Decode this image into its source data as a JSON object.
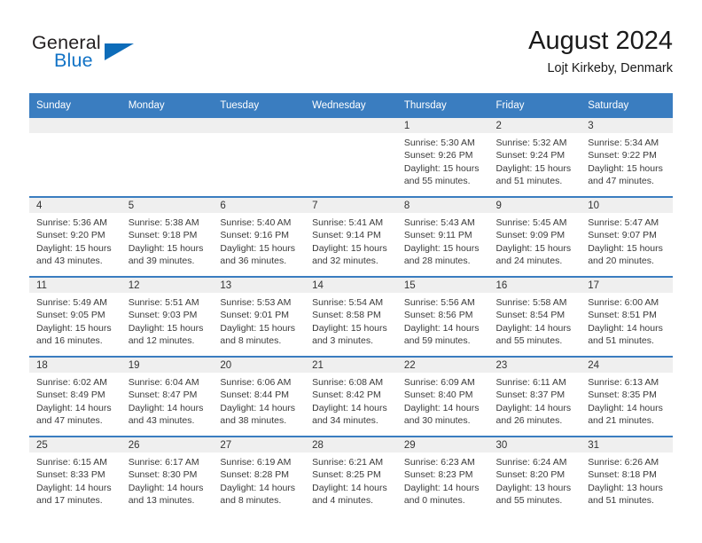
{
  "brand": {
    "word1": "General",
    "word2": "Blue",
    "logo_icon": "blue-triangle-icon",
    "colors": {
      "general": "#231f20",
      "blue": "#1273c6",
      "triangle": "#0d6cb9"
    }
  },
  "header": {
    "title": "August 2024",
    "subtitle": "Lojt Kirkeby, Denmark"
  },
  "calendar": {
    "header_bg": "#3a7dc0",
    "daynum_bg": "#efefef",
    "weekday_labels": [
      "Sunday",
      "Monday",
      "Tuesday",
      "Wednesday",
      "Thursday",
      "Friday",
      "Saturday"
    ],
    "weeks": [
      [
        {
          "day": "",
          "empty": true,
          "sunrise": "",
          "sunset": "",
          "daylight_line1": "",
          "daylight_line2": ""
        },
        {
          "day": "",
          "empty": true,
          "sunrise": "",
          "sunset": "",
          "daylight_line1": "",
          "daylight_line2": ""
        },
        {
          "day": "",
          "empty": true,
          "sunrise": "",
          "sunset": "",
          "daylight_line1": "",
          "daylight_line2": ""
        },
        {
          "day": "",
          "empty": true,
          "sunrise": "",
          "sunset": "",
          "daylight_line1": "",
          "daylight_line2": ""
        },
        {
          "day": "1",
          "empty": false,
          "sunrise": "Sunrise: 5:30 AM",
          "sunset": "Sunset: 9:26 PM",
          "daylight_line1": "Daylight: 15 hours",
          "daylight_line2": "and 55 minutes."
        },
        {
          "day": "2",
          "empty": false,
          "sunrise": "Sunrise: 5:32 AM",
          "sunset": "Sunset: 9:24 PM",
          "daylight_line1": "Daylight: 15 hours",
          "daylight_line2": "and 51 minutes."
        },
        {
          "day": "3",
          "empty": false,
          "sunrise": "Sunrise: 5:34 AM",
          "sunset": "Sunset: 9:22 PM",
          "daylight_line1": "Daylight: 15 hours",
          "daylight_line2": "and 47 minutes."
        }
      ],
      [
        {
          "day": "4",
          "empty": false,
          "sunrise": "Sunrise: 5:36 AM",
          "sunset": "Sunset: 9:20 PM",
          "daylight_line1": "Daylight: 15 hours",
          "daylight_line2": "and 43 minutes."
        },
        {
          "day": "5",
          "empty": false,
          "sunrise": "Sunrise: 5:38 AM",
          "sunset": "Sunset: 9:18 PM",
          "daylight_line1": "Daylight: 15 hours",
          "daylight_line2": "and 39 minutes."
        },
        {
          "day": "6",
          "empty": false,
          "sunrise": "Sunrise: 5:40 AM",
          "sunset": "Sunset: 9:16 PM",
          "daylight_line1": "Daylight: 15 hours",
          "daylight_line2": "and 36 minutes."
        },
        {
          "day": "7",
          "empty": false,
          "sunrise": "Sunrise: 5:41 AM",
          "sunset": "Sunset: 9:14 PM",
          "daylight_line1": "Daylight: 15 hours",
          "daylight_line2": "and 32 minutes."
        },
        {
          "day": "8",
          "empty": false,
          "sunrise": "Sunrise: 5:43 AM",
          "sunset": "Sunset: 9:11 PM",
          "daylight_line1": "Daylight: 15 hours",
          "daylight_line2": "and 28 minutes."
        },
        {
          "day": "9",
          "empty": false,
          "sunrise": "Sunrise: 5:45 AM",
          "sunset": "Sunset: 9:09 PM",
          "daylight_line1": "Daylight: 15 hours",
          "daylight_line2": "and 24 minutes."
        },
        {
          "day": "10",
          "empty": false,
          "sunrise": "Sunrise: 5:47 AM",
          "sunset": "Sunset: 9:07 PM",
          "daylight_line1": "Daylight: 15 hours",
          "daylight_line2": "and 20 minutes."
        }
      ],
      [
        {
          "day": "11",
          "empty": false,
          "sunrise": "Sunrise: 5:49 AM",
          "sunset": "Sunset: 9:05 PM",
          "daylight_line1": "Daylight: 15 hours",
          "daylight_line2": "and 16 minutes."
        },
        {
          "day": "12",
          "empty": false,
          "sunrise": "Sunrise: 5:51 AM",
          "sunset": "Sunset: 9:03 PM",
          "daylight_line1": "Daylight: 15 hours",
          "daylight_line2": "and 12 minutes."
        },
        {
          "day": "13",
          "empty": false,
          "sunrise": "Sunrise: 5:53 AM",
          "sunset": "Sunset: 9:01 PM",
          "daylight_line1": "Daylight: 15 hours",
          "daylight_line2": "and 8 minutes."
        },
        {
          "day": "14",
          "empty": false,
          "sunrise": "Sunrise: 5:54 AM",
          "sunset": "Sunset: 8:58 PM",
          "daylight_line1": "Daylight: 15 hours",
          "daylight_line2": "and 3 minutes."
        },
        {
          "day": "15",
          "empty": false,
          "sunrise": "Sunrise: 5:56 AM",
          "sunset": "Sunset: 8:56 PM",
          "daylight_line1": "Daylight: 14 hours",
          "daylight_line2": "and 59 minutes."
        },
        {
          "day": "16",
          "empty": false,
          "sunrise": "Sunrise: 5:58 AM",
          "sunset": "Sunset: 8:54 PM",
          "daylight_line1": "Daylight: 14 hours",
          "daylight_line2": "and 55 minutes."
        },
        {
          "day": "17",
          "empty": false,
          "sunrise": "Sunrise: 6:00 AM",
          "sunset": "Sunset: 8:51 PM",
          "daylight_line1": "Daylight: 14 hours",
          "daylight_line2": "and 51 minutes."
        }
      ],
      [
        {
          "day": "18",
          "empty": false,
          "sunrise": "Sunrise: 6:02 AM",
          "sunset": "Sunset: 8:49 PM",
          "daylight_line1": "Daylight: 14 hours",
          "daylight_line2": "and 47 minutes."
        },
        {
          "day": "19",
          "empty": false,
          "sunrise": "Sunrise: 6:04 AM",
          "sunset": "Sunset: 8:47 PM",
          "daylight_line1": "Daylight: 14 hours",
          "daylight_line2": "and 43 minutes."
        },
        {
          "day": "20",
          "empty": false,
          "sunrise": "Sunrise: 6:06 AM",
          "sunset": "Sunset: 8:44 PM",
          "daylight_line1": "Daylight: 14 hours",
          "daylight_line2": "and 38 minutes."
        },
        {
          "day": "21",
          "empty": false,
          "sunrise": "Sunrise: 6:08 AM",
          "sunset": "Sunset: 8:42 PM",
          "daylight_line1": "Daylight: 14 hours",
          "daylight_line2": "and 34 minutes."
        },
        {
          "day": "22",
          "empty": false,
          "sunrise": "Sunrise: 6:09 AM",
          "sunset": "Sunset: 8:40 PM",
          "daylight_line1": "Daylight: 14 hours",
          "daylight_line2": "and 30 minutes."
        },
        {
          "day": "23",
          "empty": false,
          "sunrise": "Sunrise: 6:11 AM",
          "sunset": "Sunset: 8:37 PM",
          "daylight_line1": "Daylight: 14 hours",
          "daylight_line2": "and 26 minutes."
        },
        {
          "day": "24",
          "empty": false,
          "sunrise": "Sunrise: 6:13 AM",
          "sunset": "Sunset: 8:35 PM",
          "daylight_line1": "Daylight: 14 hours",
          "daylight_line2": "and 21 minutes."
        }
      ],
      [
        {
          "day": "25",
          "empty": false,
          "sunrise": "Sunrise: 6:15 AM",
          "sunset": "Sunset: 8:33 PM",
          "daylight_line1": "Daylight: 14 hours",
          "daylight_line2": "and 17 minutes."
        },
        {
          "day": "26",
          "empty": false,
          "sunrise": "Sunrise: 6:17 AM",
          "sunset": "Sunset: 8:30 PM",
          "daylight_line1": "Daylight: 14 hours",
          "daylight_line2": "and 13 minutes."
        },
        {
          "day": "27",
          "empty": false,
          "sunrise": "Sunrise: 6:19 AM",
          "sunset": "Sunset: 8:28 PM",
          "daylight_line1": "Daylight: 14 hours",
          "daylight_line2": "and 8 minutes."
        },
        {
          "day": "28",
          "empty": false,
          "sunrise": "Sunrise: 6:21 AM",
          "sunset": "Sunset: 8:25 PM",
          "daylight_line1": "Daylight: 14 hours",
          "daylight_line2": "and 4 minutes."
        },
        {
          "day": "29",
          "empty": false,
          "sunrise": "Sunrise: 6:23 AM",
          "sunset": "Sunset: 8:23 PM",
          "daylight_line1": "Daylight: 14 hours",
          "daylight_line2": "and 0 minutes."
        },
        {
          "day": "30",
          "empty": false,
          "sunrise": "Sunrise: 6:24 AM",
          "sunset": "Sunset: 8:20 PM",
          "daylight_line1": "Daylight: 13 hours",
          "daylight_line2": "and 55 minutes."
        },
        {
          "day": "31",
          "empty": false,
          "sunrise": "Sunrise: 6:26 AM",
          "sunset": "Sunset: 8:18 PM",
          "daylight_line1": "Daylight: 13 hours",
          "daylight_line2": "and 51 minutes."
        }
      ]
    ]
  }
}
